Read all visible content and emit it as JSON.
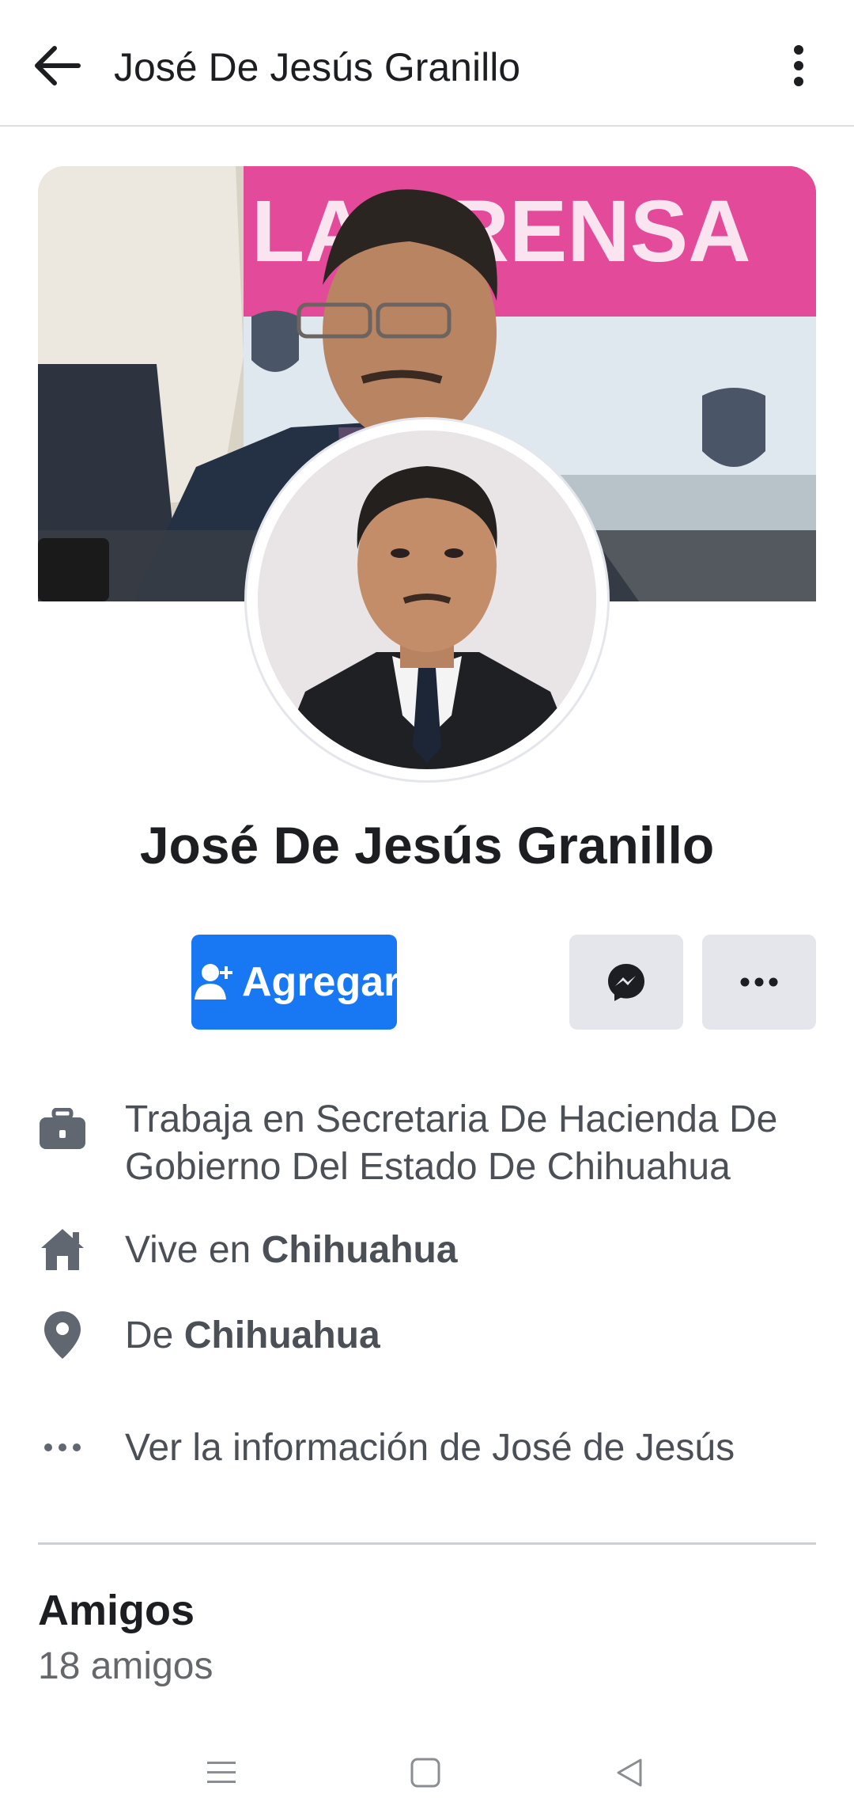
{
  "appbar": {
    "title": "José De Jesús Granillo",
    "back_icon": "arrow-left-icon",
    "menu_icon": "more-vertical-icon"
  },
  "profile": {
    "name": "José De Jesús Granillo",
    "cover_text": "LA PRENSA"
  },
  "actions": {
    "add_label": "Agregar",
    "add_icon": "add-friend-icon",
    "message_icon": "messenger-icon",
    "more_icon": "more-horizontal-icon",
    "primary_color": "#1877f2",
    "secondary_color": "#e4e6eb"
  },
  "info": {
    "work": {
      "icon": "briefcase-icon",
      "text": "Trabaja en Secretaria De Hacienda De Gobierno Del Estado De Chihuahua"
    },
    "lives": {
      "icon": "home-icon",
      "prefix": "Vive en ",
      "place": "Chihuahua"
    },
    "from": {
      "icon": "location-pin-icon",
      "prefix": "De ",
      "place": "Chihuahua"
    },
    "more": {
      "icon": "more-horizontal-icon",
      "text": "Ver la información de José de Jesús"
    }
  },
  "friends": {
    "title": "Amigos",
    "count_text": "18 amigos"
  },
  "navbar": {
    "menu_icon": "recent-apps-icon",
    "home_icon": "home-square-icon",
    "back_icon": "back-triangle-icon"
  }
}
